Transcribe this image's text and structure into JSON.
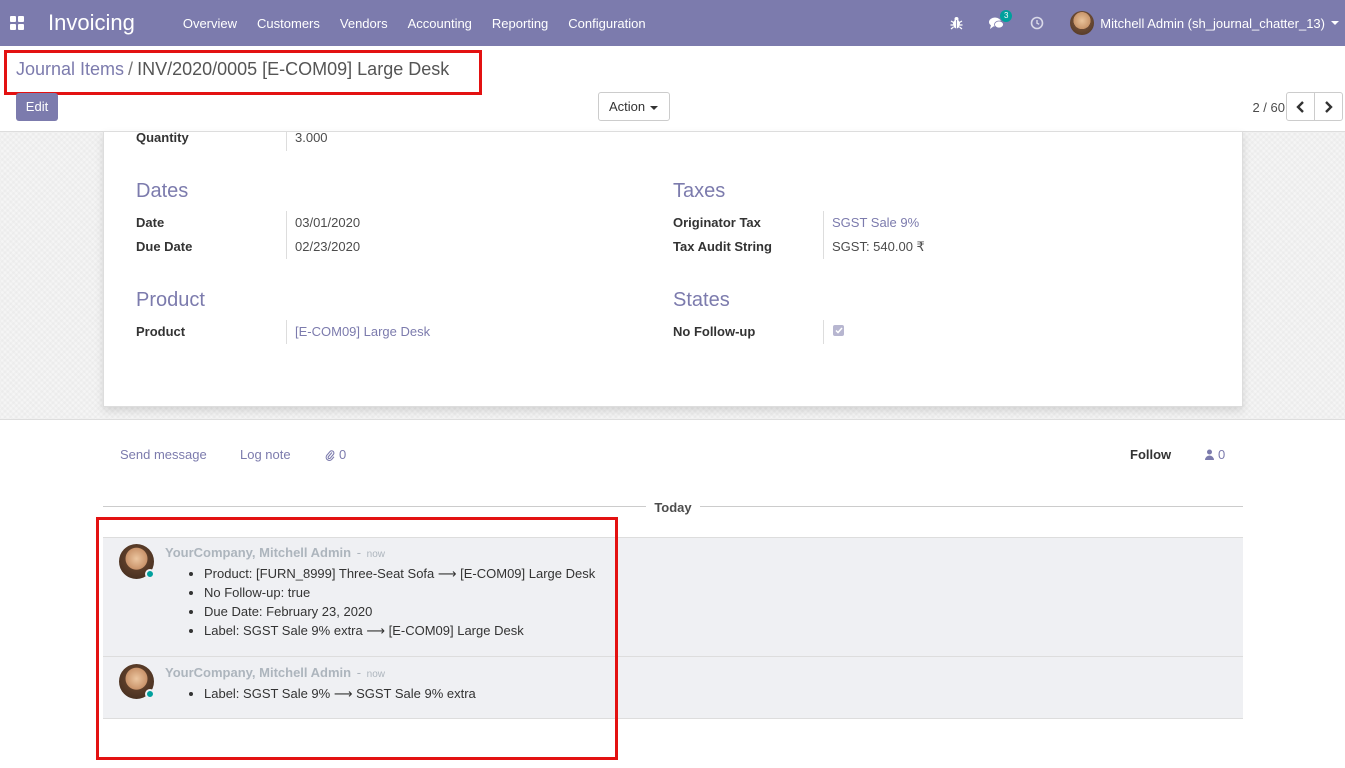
{
  "navbar": {
    "app_name": "Invoicing",
    "menu": [
      "Overview",
      "Customers",
      "Vendors",
      "Accounting",
      "Reporting",
      "Configuration"
    ],
    "messages_count": "3",
    "user_name": "Mitchell Admin (sh_journal_chatter_13)"
  },
  "breadcrumb": {
    "parent": "Journal Items",
    "separator": "/",
    "current": "INV/2020/0005 [E-COM09] Large Desk"
  },
  "control": {
    "edit_label": "Edit",
    "action_label": "Action",
    "pager_text": "2 / 60"
  },
  "form": {
    "quantity_label": "Quantity",
    "quantity_value": "3.000",
    "dates": {
      "title": "Dates",
      "date_label": "Date",
      "date_value": "03/01/2020",
      "due_label": "Due Date",
      "due_value": "02/23/2020"
    },
    "taxes": {
      "title": "Taxes",
      "orig_label": "Originator Tax",
      "orig_value": "SGST Sale 9%",
      "audit_label": "Tax Audit String",
      "audit_value": "SGST: 540.00 ₹"
    },
    "product": {
      "title": "Product",
      "product_label": "Product",
      "product_value": "[E-COM09] Large Desk"
    },
    "states": {
      "title": "States",
      "followup_label": "No Follow-up",
      "followup_checked": true
    }
  },
  "chatter": {
    "send_message": "Send message",
    "log_note": "Log note",
    "attachments": "0",
    "follow": "Follow",
    "followers": "0",
    "today": "Today",
    "messages": [
      {
        "author": "YourCompany, Mitchell Admin",
        "date": "now",
        "changes": [
          "Product: [FURN_8999] Three-Seat Sofa ⟶ [E-COM09] Large Desk",
          "No Follow-up: true",
          "Due Date: February 23, 2020",
          "Label: SGST Sale 9% extra ⟶ [E-COM09] Large Desk"
        ]
      },
      {
        "author": "YourCompany, Mitchell Admin",
        "date": "now",
        "changes": [
          "Label: SGST Sale 9% ⟶ SGST Sale 9% extra"
        ]
      }
    ]
  },
  "colors": {
    "brand": "#7c7bad",
    "highlight": "#e31111",
    "online": "#00a09d"
  }
}
